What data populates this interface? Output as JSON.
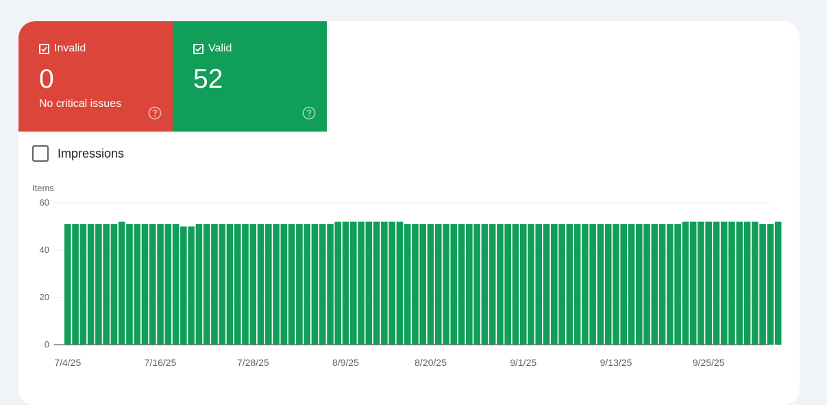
{
  "tiles": {
    "invalid": {
      "label": "Invalid",
      "value": "0",
      "subtext": "No critical issues",
      "checked": true,
      "color": "#dc4539"
    },
    "valid": {
      "label": "Valid",
      "value": "52",
      "subtext": "",
      "checked": true,
      "color": "#119e58"
    }
  },
  "impressions": {
    "label": "Impressions",
    "checked": false
  },
  "chart_data": {
    "type": "bar",
    "ylabel": "Items",
    "ylim": [
      0,
      60
    ],
    "yticks": [
      0,
      20,
      40,
      60
    ],
    "x_tick_labels": [
      "7/4/25",
      "7/16/25",
      "7/28/25",
      "8/9/25",
      "8/20/25",
      "9/1/25",
      "9/13/25",
      "9/25/25"
    ],
    "x_tick_indices": [
      0,
      12,
      24,
      36,
      47,
      59,
      71,
      83
    ],
    "grid": true,
    "bar_color": "#119e58",
    "series": [
      {
        "values": [
          51,
          51,
          51,
          51,
          51,
          51,
          51,
          52,
          51,
          51,
          51,
          51,
          51,
          51,
          51,
          50,
          50,
          51,
          51,
          51,
          51,
          51,
          51,
          51,
          51,
          51,
          51,
          51,
          51,
          51,
          51,
          51,
          51,
          51,
          51,
          52,
          52,
          52,
          52,
          52,
          52,
          52,
          52,
          52,
          51,
          51,
          51,
          51,
          51,
          51,
          51,
          51,
          51,
          51,
          51,
          51,
          51,
          51,
          51,
          51,
          51,
          51,
          51,
          51,
          51,
          51,
          51,
          51,
          51,
          51,
          51,
          51,
          51,
          51,
          51,
          51,
          51,
          51,
          51,
          51,
          52,
          52,
          52,
          52,
          52,
          52,
          52,
          52,
          52,
          52,
          51,
          51,
          52
        ]
      }
    ]
  }
}
